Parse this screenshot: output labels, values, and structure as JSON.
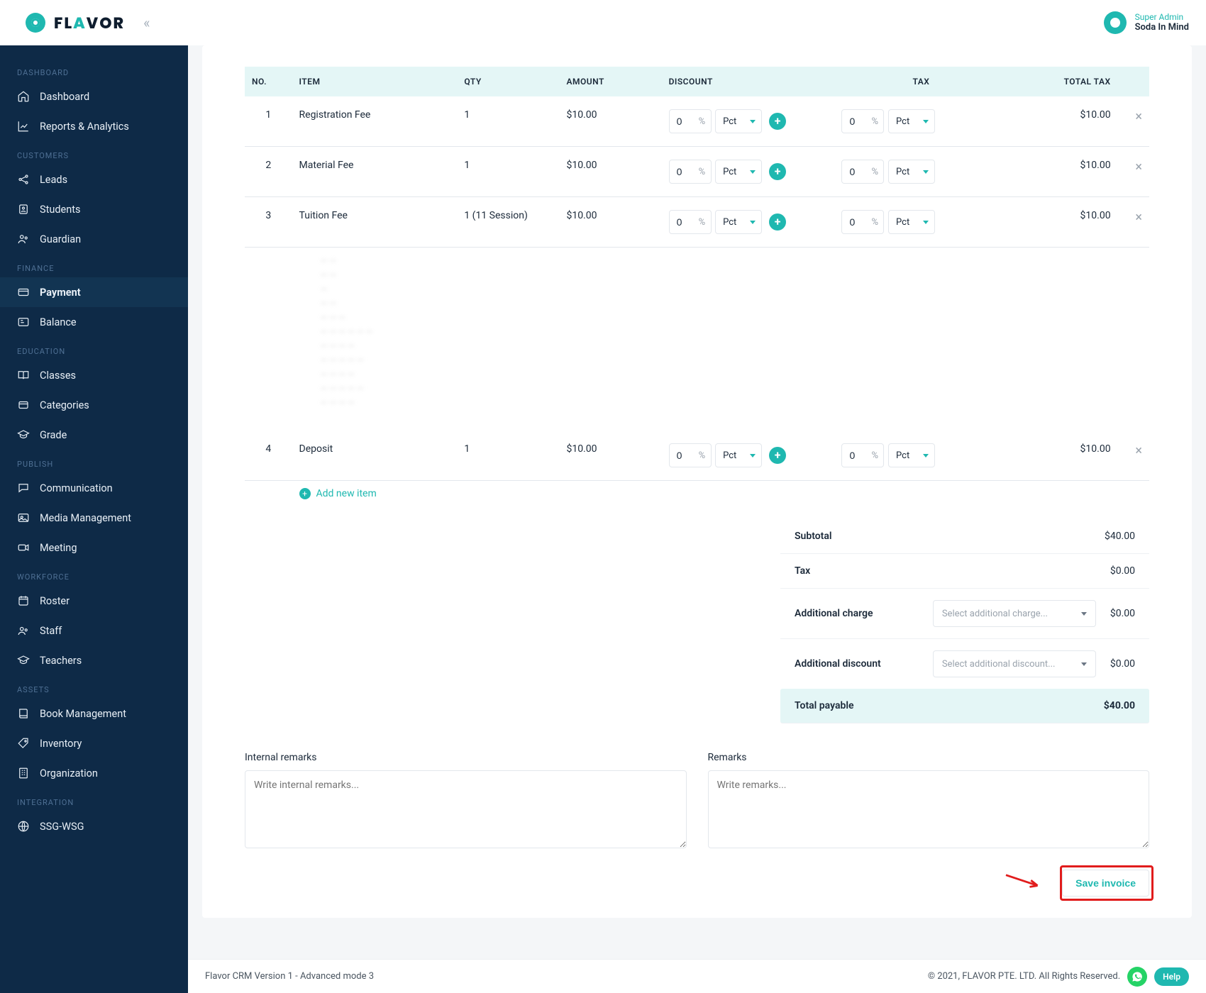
{
  "brand": {
    "word_part1": "FL",
    "word_accent": "A",
    "word_part2": "VOR"
  },
  "user": {
    "role": "Super Admin",
    "name": "Soda In Mind"
  },
  "sidebar": {
    "sections": [
      {
        "label": "DASHBOARD",
        "items": [
          {
            "name": "dashboard",
            "icon": "home",
            "label": "Dashboard"
          },
          {
            "name": "reports",
            "icon": "chart",
            "label": "Reports & Analytics"
          }
        ]
      },
      {
        "label": "CUSTOMERS",
        "items": [
          {
            "name": "leads",
            "icon": "share",
            "label": "Leads"
          },
          {
            "name": "students",
            "icon": "student",
            "label": "Students"
          },
          {
            "name": "guardian",
            "icon": "guardian",
            "label": "Guardian"
          }
        ]
      },
      {
        "label": "FINANCE",
        "items": [
          {
            "name": "payment",
            "icon": "card",
            "label": "Payment",
            "active": true
          },
          {
            "name": "balance",
            "icon": "balance",
            "label": "Balance"
          }
        ]
      },
      {
        "label": "EDUCATION",
        "items": [
          {
            "name": "classes",
            "icon": "book-open",
            "label": "Classes"
          },
          {
            "name": "categories",
            "icon": "box",
            "label": "Categories"
          },
          {
            "name": "grade",
            "icon": "grad",
            "label": "Grade"
          }
        ]
      },
      {
        "label": "PUBLISH",
        "items": [
          {
            "name": "communication",
            "icon": "chat",
            "label": "Communication"
          },
          {
            "name": "media",
            "icon": "media",
            "label": "Media Management"
          },
          {
            "name": "meeting",
            "icon": "video",
            "label": "Meeting"
          }
        ]
      },
      {
        "label": "WORKFORCE",
        "items": [
          {
            "name": "roster",
            "icon": "calendar",
            "label": "Roster"
          },
          {
            "name": "staff",
            "icon": "people",
            "label": "Staff"
          },
          {
            "name": "teachers",
            "icon": "grad",
            "label": "Teachers"
          }
        ]
      },
      {
        "label": "ASSETS",
        "items": [
          {
            "name": "book-mgmt",
            "icon": "book",
            "label": "Book Management"
          },
          {
            "name": "inventory",
            "icon": "tag",
            "label": "Inventory"
          },
          {
            "name": "organization",
            "icon": "org",
            "label": "Organization"
          }
        ]
      },
      {
        "label": "INTEGRATION",
        "items": [
          {
            "name": "ssg-wsg",
            "icon": "globe",
            "label": "SSG-WSG"
          }
        ]
      }
    ]
  },
  "table": {
    "headers": {
      "no": "NO.",
      "item": "ITEM",
      "qty": "QTY",
      "amount": "AMOUNT",
      "discount": "DISCOUNT",
      "tax": "TAX",
      "total_tax": "TOTAL TAX"
    },
    "rows": [
      {
        "no": "1",
        "item": "Registration Fee",
        "qty": "1",
        "amount": "$10.00",
        "discount_val": "0",
        "discount_type": "Pct",
        "tax_val": "0",
        "tax_type": "Pct",
        "total_tax": "$10.00"
      },
      {
        "no": "2",
        "item": "Material Fee",
        "qty": "1",
        "amount": "$10.00",
        "discount_val": "0",
        "discount_type": "Pct",
        "tax_val": "0",
        "tax_type": "Pct",
        "total_tax": "$10.00"
      },
      {
        "no": "3",
        "item": "Tuition Fee",
        "qty": "1 (11 Session)",
        "amount": "$10.00",
        "discount_val": "0",
        "discount_type": "Pct",
        "tax_val": "0",
        "tax_type": "Pct",
        "total_tax": "$10.00"
      },
      {
        "no": "4",
        "item": "Deposit",
        "qty": "1",
        "amount": "$10.00",
        "discount_val": "0",
        "discount_type": "Pct",
        "tax_val": "0",
        "tax_type": "Pct",
        "total_tax": "$10.00"
      }
    ],
    "pct_suffix": "%",
    "add_item": "Add new item"
  },
  "totals": {
    "subtotal_label": "Subtotal",
    "subtotal_value": "$40.00",
    "tax_label": "Tax",
    "tax_value": "$0.00",
    "addl_charge_label": "Additional charge",
    "addl_charge_placeholder": "Select additional charge...",
    "addl_charge_value": "$0.00",
    "addl_disc_label": "Additional discount",
    "addl_disc_placeholder": "Select additional discount...",
    "addl_disc_value": "$0.00",
    "payable_label": "Total payable",
    "payable_value": "$40.00"
  },
  "remarks": {
    "internal_label": "Internal remarks",
    "internal_placeholder": "Write internal remarks...",
    "public_label": "Remarks",
    "public_placeholder": "Write remarks..."
  },
  "actions": {
    "save": "Save invoice"
  },
  "footer": {
    "left": "Flavor CRM Version 1 - Advanced mode 3",
    "right": "© 2021, FLAVOR PTE. LTD. All Rights Reserved.",
    "help": "Help"
  }
}
